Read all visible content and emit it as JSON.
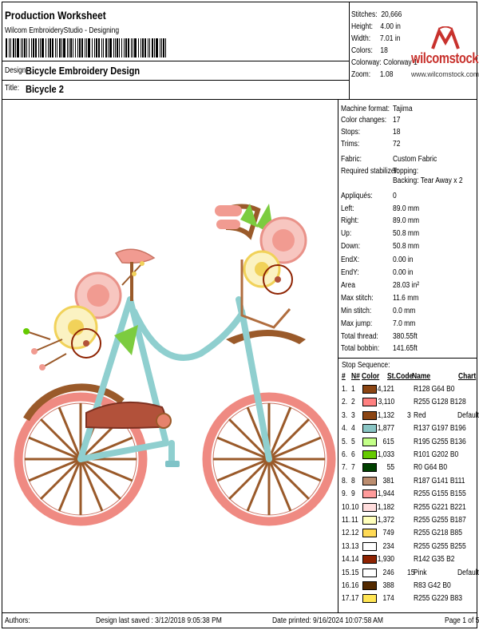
{
  "header": {
    "title": "Production Worksheet",
    "subtitle": "Wilcom EmbroideryStudio - Designing",
    "design_label": "Design:",
    "design_value": "Bicycle Embroidery Design",
    "title_label": "Title:",
    "title_value": "Bicycle 2"
  },
  "stats": [
    {
      "k": "Stitches:",
      "v": "20,666"
    },
    {
      "k": "Height:",
      "v": "4.00 in"
    },
    {
      "k": "Width:",
      "v": "7.01 in"
    },
    {
      "k": "Colors:",
      "v": "18"
    },
    {
      "k": "Colorway:",
      "v": "Colorway 1"
    },
    {
      "k": "Zoom:",
      "v": "1.08"
    }
  ],
  "logo": {
    "text": "wilcomstock",
    "url": "www.wilcomstock.com",
    "color": "#c8322d"
  },
  "info": [
    {
      "k": "Machine format:",
      "v": "Tajima"
    },
    {
      "k": "Color changes:",
      "v": "17"
    },
    {
      "k": "Stops:",
      "v": "18"
    },
    {
      "k": "Trims:",
      "v": "72"
    },
    {
      "k": "Fabric:",
      "v": "Custom Fabric"
    },
    {
      "k": "Required stabilizer:",
      "v": "Topping:"
    },
    {
      "k": "",
      "v": "Backing: Tear Away x 2"
    },
    {
      "k": "Appliqués:",
      "v": "0"
    },
    {
      "k": "Left:",
      "v": "89.0 mm"
    },
    {
      "k": "Right:",
      "v": "89.0 mm"
    },
    {
      "k": "Up:",
      "v": "50.8 mm"
    },
    {
      "k": "Down:",
      "v": "50.8 mm"
    },
    {
      "k": "EndX:",
      "v": "0.00 in"
    },
    {
      "k": "EndY:",
      "v": "0.00 in"
    },
    {
      "k": "Area",
      "v": "28.03 in²"
    },
    {
      "k": "Max stitch:",
      "v": "11.6 mm"
    },
    {
      "k": "Min stitch:",
      "v": "0.0 mm"
    },
    {
      "k": "Max jump:",
      "v": "7.0 mm"
    },
    {
      "k": "Total thread:",
      "v": "380.55ft"
    },
    {
      "k": "Total bobbin:",
      "v": "141.65ft"
    }
  ],
  "stop_sequence": {
    "title": "Stop Sequence:",
    "headers": [
      "#",
      "N#",
      "Color",
      "St.",
      "Code",
      "Name",
      "Chart"
    ],
    "rows": [
      {
        "n": "1.",
        "nn": "1",
        "color": "#8b4513",
        "st": "4,121",
        "code": "",
        "name": "R128 G64 B0",
        "chart": ""
      },
      {
        "n": "2.",
        "nn": "2",
        "color": "#ff8080",
        "st": "3,110",
        "code": "",
        "name": "R255 G128 B128",
        "chart": ""
      },
      {
        "n": "3.",
        "nn": "3",
        "color": "#8b4513",
        "st": "1,132",
        "code": "3",
        "name": "Red",
        "chart": "Default"
      },
      {
        "n": "4.",
        "nn": "4",
        "color": "#89c5c4",
        "st": "1,877",
        "code": "",
        "name": "R137 G197 B196",
        "chart": ""
      },
      {
        "n": "5.",
        "nn": "5",
        "color": "#c3ff88",
        "st": "615",
        "code": "",
        "name": "R195 G255 B136",
        "chart": ""
      },
      {
        "n": "6.",
        "nn": "6",
        "color": "#65ca00",
        "st": "1,033",
        "code": "",
        "name": "R101 G202 B0",
        "chart": ""
      },
      {
        "n": "7.",
        "nn": "7",
        "color": "#004000",
        "st": "55",
        "code": "",
        "name": "R0 G64 B0",
        "chart": ""
      },
      {
        "n": "8.",
        "nn": "8",
        "color": "#bb8d6f",
        "st": "381",
        "code": "",
        "name": "R187 G141 B111",
        "chart": ""
      },
      {
        "n": "9.",
        "nn": "9",
        "color": "#ff9b9b",
        "st": "1,944",
        "code": "",
        "name": "R255 G155 B155",
        "chart": ""
      },
      {
        "n": "10.",
        "nn": "10",
        "color": "#ffdddd",
        "st": "1,182",
        "code": "",
        "name": "R255 G221 B221",
        "chart": ""
      },
      {
        "n": "11.",
        "nn": "11",
        "color": "#ffffbb",
        "st": "1,372",
        "code": "",
        "name": "R255 G255 B187",
        "chart": ""
      },
      {
        "n": "12.",
        "nn": "12",
        "color": "#ffda55",
        "st": "749",
        "code": "",
        "name": "R255 G218 B85",
        "chart": ""
      },
      {
        "n": "13.",
        "nn": "13",
        "color": "#ffffff",
        "st": "234",
        "code": "",
        "name": "R255 G255 B255",
        "chart": ""
      },
      {
        "n": "14.",
        "nn": "14",
        "color": "#8e2302",
        "st": "1,930",
        "code": "",
        "name": "R142 G35 B2",
        "chart": ""
      },
      {
        "n": "15.",
        "nn": "15",
        "color": "#ffffff",
        "st": "246",
        "code": "15",
        "name": "Pink",
        "chart": "Default"
      },
      {
        "n": "16.",
        "nn": "16",
        "color": "#532a00",
        "st": "388",
        "code": "",
        "name": "R83 G42 B0",
        "chart": ""
      },
      {
        "n": "17.",
        "nn": "17",
        "color": "#ffe553",
        "st": "174",
        "code": "",
        "name": "R255 G229 B83",
        "chart": ""
      }
    ]
  },
  "footer": {
    "authors": "Authors:",
    "saved": "Design last saved : 3/12/2018 9:05:38 PM",
    "printed": "Date printed: 9/16/2024 10:07:58 AM",
    "page": "Page 1 of 5"
  }
}
